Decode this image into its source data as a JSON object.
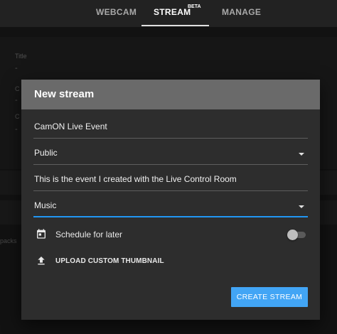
{
  "tabs": {
    "webcam": "WEBCAM",
    "stream": "STREAM",
    "stream_badge": "BETA",
    "manage": "MANAGE"
  },
  "background": {
    "title_label": "Title",
    "title_value": "-",
    "field2_label": "C",
    "field2_value": "-",
    "field3_label": "C",
    "field3_value": "-",
    "side_text": "packs"
  },
  "dialog": {
    "title": "New stream",
    "event_name": "CamON Live Event",
    "privacy": "Public",
    "description": "This is the event I created with the Live Control Room",
    "category": "Music",
    "schedule_label": "Schedule for later",
    "schedule_enabled": false,
    "thumbnail_label": "UPLOAD CUSTOM THUMBNAIL",
    "create_button": "CREATE STREAM"
  },
  "icons": {
    "calendar": "calendar-icon",
    "upload": "upload-icon"
  },
  "colors": {
    "accent": "#42a5f5",
    "focus_underline": "#2196f3",
    "dialog_header": "#6a6a6a",
    "dialog_bg": "#2d2d2d"
  }
}
